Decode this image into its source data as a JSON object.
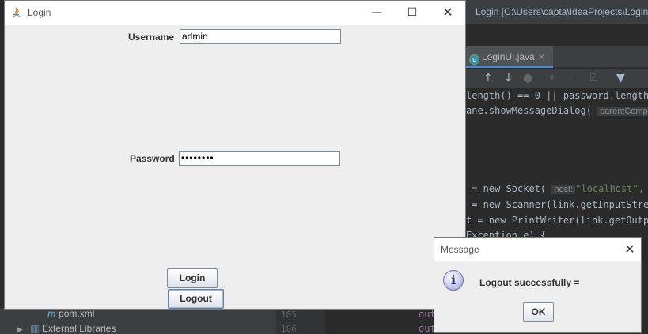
{
  "ide": {
    "window_title": "Login [C:\\Users\\capta\\IdeaProjects\\Login",
    "tab": {
      "label": "LoginUI.java",
      "icon": "class-icon"
    },
    "code_lines": [
      {
        "text": "length() == 0 || password.length("
      },
      {
        "text": "ane.showMessageDialog( ",
        "hint": "parentCompo"
      },
      {
        "text": " = new Socket( ",
        "hint": "host:",
        "tail": "\"localhost\","
      },
      {
        "text": " = new Scanner(link.getInputStrea"
      },
      {
        "text": "t = new PrintWriter(link.getOutpu"
      },
      {
        "text": "Exception e) {"
      }
    ],
    "project_items": [
      {
        "label": "pom.xml",
        "icon": "maven-file-icon"
      },
      {
        "label": "External Libraries",
        "icon": "libraries-icon"
      }
    ],
    "gutter_lines": [
      "105",
      "106"
    ],
    "bottom_code": [
      "out",
      "out"
    ]
  },
  "login": {
    "title": "Login",
    "username_label": "Username",
    "username_value": "admin",
    "password_label": "Password",
    "password_value": "••••••••",
    "login_button": "Login",
    "logout_button": "Logout"
  },
  "message": {
    "title": "Message",
    "text": "Logout successfully =",
    "ok_button": "OK"
  }
}
